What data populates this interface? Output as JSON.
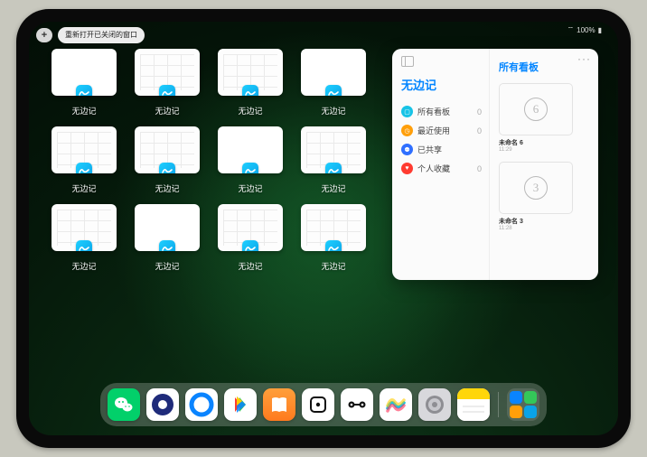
{
  "status": {
    "battery": "100%",
    "signal": "•••"
  },
  "top": {
    "plus": "+",
    "reopen_label": "重新打开已关闭的窗口"
  },
  "tiles": [
    {
      "label": "无边记",
      "kind": "blank"
    },
    {
      "label": "无边记",
      "kind": "grid"
    },
    {
      "label": "无边记",
      "kind": "grid"
    },
    {
      "label": "无边记",
      "kind": "blank"
    },
    {
      "label": "无边记",
      "kind": "grid"
    },
    {
      "label": "无边记",
      "kind": "grid"
    },
    {
      "label": "无边记",
      "kind": "blank"
    },
    {
      "label": "无边记",
      "kind": "grid"
    },
    {
      "label": "无边记",
      "kind": "grid"
    },
    {
      "label": "无边记",
      "kind": "blank"
    },
    {
      "label": "无边记",
      "kind": "grid"
    },
    {
      "label": "无边记",
      "kind": "grid"
    }
  ],
  "panel": {
    "app_title": "无边记",
    "boards_title": "所有看板",
    "nav": [
      {
        "label": "所有看板",
        "count": "0",
        "color": "#17c3e6",
        "glyph": "▢"
      },
      {
        "label": "最近使用",
        "count": "0",
        "color": "#ff9f0a",
        "glyph": "◷"
      },
      {
        "label": "已共享",
        "count": "",
        "color": "#2f6fff",
        "glyph": "⚉"
      },
      {
        "label": "个人收藏",
        "count": "0",
        "color": "#ff3b30",
        "glyph": "♥"
      }
    ],
    "boards": [
      {
        "name": "未命名 6",
        "time": "11:29",
        "sketch": "6"
      },
      {
        "name": "未命名 3",
        "time": "11:28",
        "sketch": "3"
      }
    ]
  },
  "dock": [
    {
      "id": "wechat",
      "bg": "#02d06a",
      "svg": "wechat"
    },
    {
      "id": "uc",
      "bg": "#ffffff",
      "svg": "uc"
    },
    {
      "id": "qqbrowser",
      "bg": "#ffffff",
      "svg": "qq"
    },
    {
      "id": "video",
      "bg": "#ffffff",
      "svg": "play"
    },
    {
      "id": "books",
      "bg": "linear-gradient(180deg,#ff9f3b,#ff7a1e)",
      "svg": "books"
    },
    {
      "id": "dice",
      "bg": "#ffffff",
      "svg": "dice"
    },
    {
      "id": "connect",
      "bg": "#ffffff",
      "svg": "dumbbell"
    },
    {
      "id": "freeform",
      "bg": "#ffffff",
      "svg": "freeform"
    },
    {
      "id": "settings",
      "bg": "#d8d8dc",
      "svg": "gear"
    },
    {
      "id": "notes",
      "bg": "#ffffff",
      "svg": "notes"
    }
  ]
}
